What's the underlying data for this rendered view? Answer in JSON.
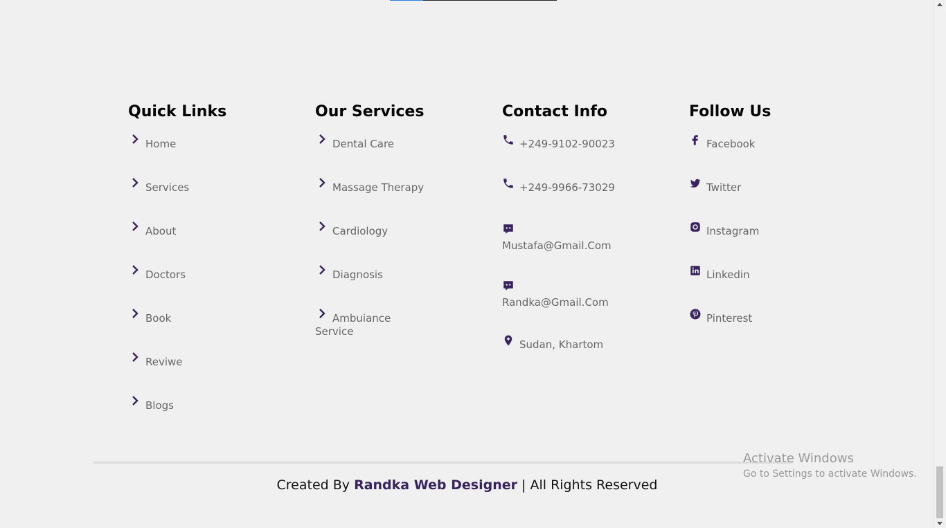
{
  "quick_links": {
    "title": "Quick Links",
    "items": [
      "Home",
      "Services",
      "About",
      "Doctors",
      "Book",
      "Reviwe",
      "Blogs"
    ]
  },
  "services": {
    "title": "Our Services",
    "items": [
      "Dental Care",
      "Massage Therapy",
      "Cardiology",
      "Diagnosis",
      "Ambuiance Service"
    ]
  },
  "contact": {
    "title": "Contact Info",
    "phone1": "+249-9102-90023",
    "phone2": "+249-9966-73029",
    "email1": "Mustafa@Gmail.Com",
    "email2": "Randka@Gmail.Com",
    "location": "Sudan, Khartom"
  },
  "follow": {
    "title": "Follow Us",
    "items": [
      "Facebook",
      "Twitter",
      "Instagram",
      "Linkedin",
      "Pinterest"
    ]
  },
  "footer": {
    "prefix": "Created By",
    "brand": "Randka Web Designer",
    "suffix": "| All Rights Reserved"
  },
  "watermark": {
    "line1": "Activate Windows",
    "line2": "Go to Settings to activate Windows."
  },
  "colors": {
    "accent": "#37235e",
    "background": "#f1f0f0"
  }
}
